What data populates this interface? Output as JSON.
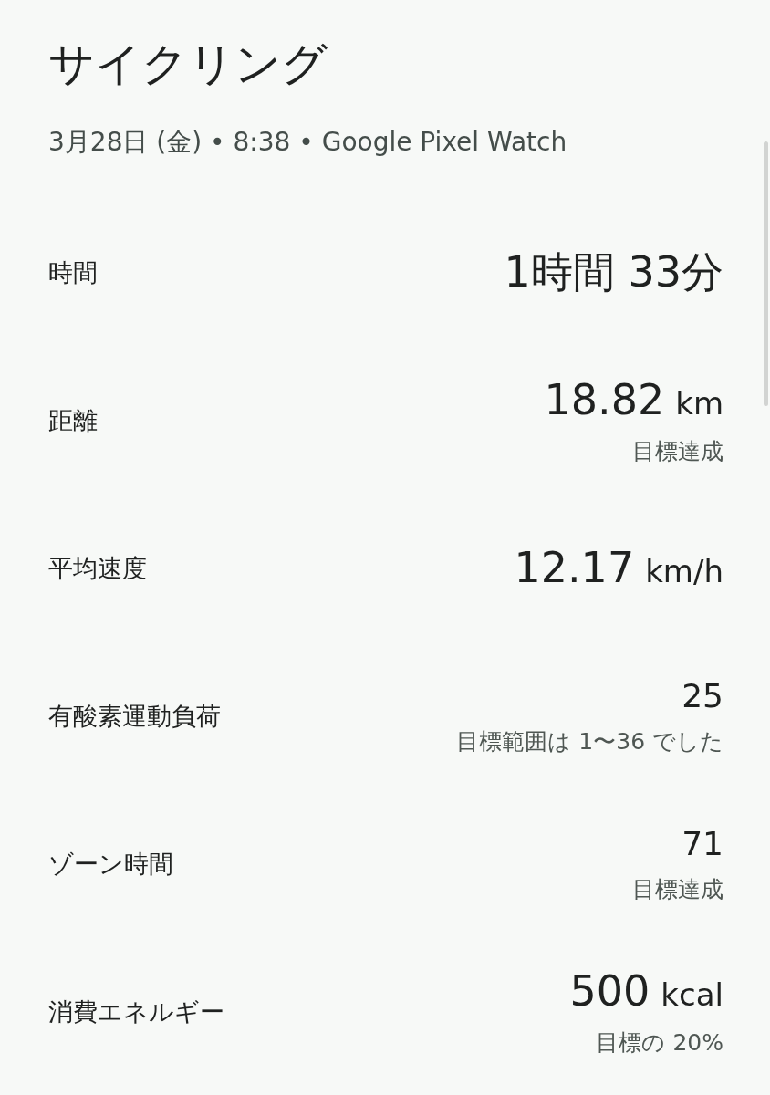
{
  "title": "サイクリング",
  "subtitle": "3月28日 (金) • 8:38 • Google Pixel Watch",
  "metrics": [
    {
      "label": "時間",
      "kind": "large",
      "value": "1時間 33分"
    },
    {
      "label": "距離",
      "kind": "large",
      "value": "18.82",
      "unit": "km",
      "note": "目標達成"
    },
    {
      "label": "平均速度",
      "kind": "large",
      "value": "12.17",
      "unit": "km/h"
    },
    {
      "label": "有酸素運動負荷",
      "kind": "small",
      "value": "25",
      "note": "目標範囲は 1〜36 でした"
    },
    {
      "label": "ゾーン時間",
      "kind": "small",
      "value": "71",
      "note": "目標達成"
    },
    {
      "label": "消費エネルギー",
      "kind": "large",
      "value": "500",
      "unit": "kcal",
      "note": "目標の 20%"
    }
  ]
}
